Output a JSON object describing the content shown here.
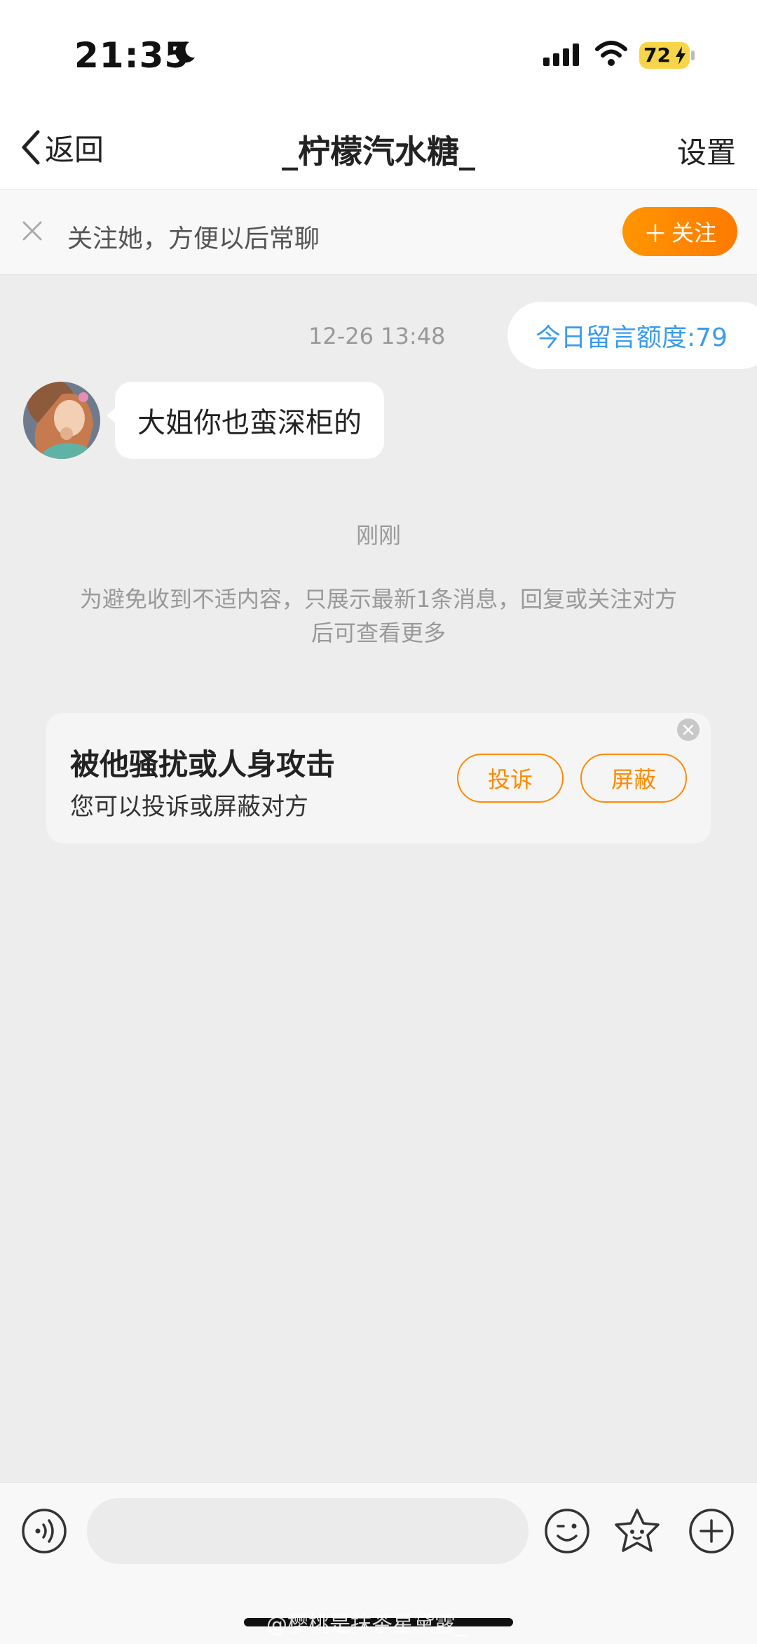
{
  "status_bar": {
    "time": "21:35",
    "battery": "72"
  },
  "nav": {
    "back_label": "返回",
    "title": "_柠檬汽水糖_",
    "settings_label": "设置"
  },
  "follow_banner": {
    "text": "关注她，方便以后常聊",
    "follow_button": "关注"
  },
  "chat": {
    "quota_text": "今日留言额度:79",
    "timestamp": "12-26 13:48",
    "message": "大姐你也蛮深柜的",
    "time_label": "刚刚",
    "notice_line1": "为避免收到不适内容，只展示最新1条消息，回复或关注对方",
    "notice_line2": "后可查看更多"
  },
  "report_card": {
    "title": "被他骚扰或人身攻击",
    "subtitle": "您可以投诉或屏蔽对方",
    "complain_button": "投诉",
    "block_button": "屏蔽"
  },
  "input_bar": {
    "placeholder": ""
  },
  "watermark": "@樱桃是抹茶星黛露_",
  "colors": {
    "accent_orange": "#ff8a00",
    "link_blue": "#3a9bf0",
    "background": "#ededed"
  }
}
